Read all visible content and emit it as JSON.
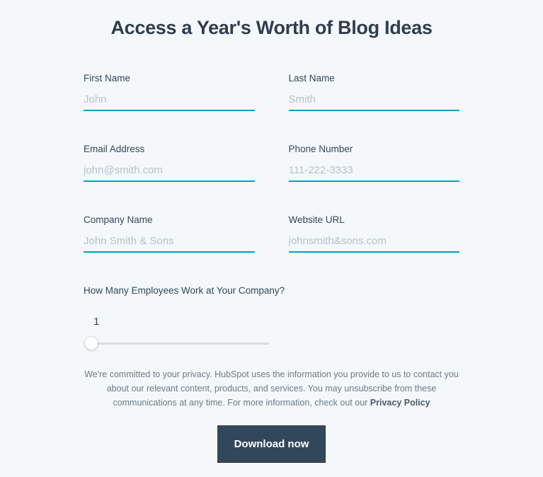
{
  "title": "Access a Year's Worth of Blog Ideas",
  "fields": {
    "first_name": {
      "label": "First Name",
      "placeholder": "John",
      "value": ""
    },
    "last_name": {
      "label": "Last Name",
      "placeholder": "Smith",
      "value": ""
    },
    "email": {
      "label": "Email Address",
      "placeholder": "john@smith.com",
      "value": ""
    },
    "phone": {
      "label": "Phone Number",
      "placeholder": "111-222-3333",
      "value": ""
    },
    "company": {
      "label": "Company Name",
      "placeholder": "John Smith & Sons",
      "value": ""
    },
    "website": {
      "label": "Website URL",
      "placeholder": "johnsmith&sons.com",
      "value": ""
    }
  },
  "employees": {
    "label": "How Many Employees Work at Your Company?",
    "value": "1"
  },
  "privacy": {
    "text_before": "We're committed to your privacy. HubSpot uses the information you provide to us to contact you about our relevant content, products, and services. You may unsubscribe from these communications at any time. For more information, check out our ",
    "link_text": "Privacy Policy"
  },
  "cta_label": "Download now",
  "colors": {
    "accent": "#00a4bd",
    "text": "#33475b",
    "button_bg": "#33475b"
  }
}
